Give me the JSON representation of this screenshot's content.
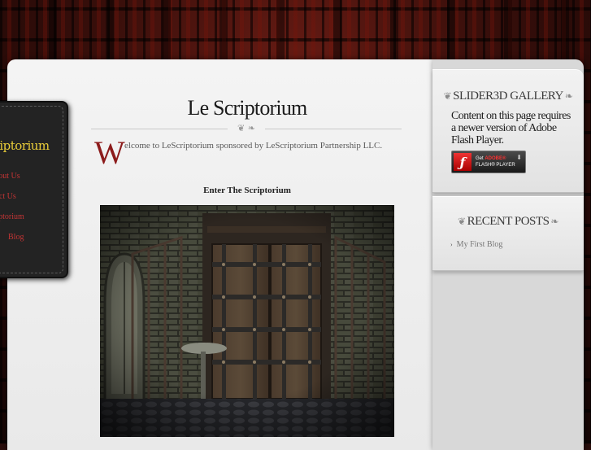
{
  "nav": {
    "title": "Scriptorium",
    "items": [
      "About Us",
      "Contact Us",
      "Scriptorium",
      "Blog"
    ]
  },
  "main": {
    "site_title": "Le Scriptorium",
    "drop_cap": "W",
    "intro": "elcome to LeScriptorium sponsored by LeScriptorium Partnership LLC.",
    "enter_link": "Enter The Scriptorium"
  },
  "sidebar": {
    "gallery_title": "SLIDER3D GALLERY",
    "flash_message": "Content on this page requires a newer version of Adobe Flash Player.",
    "flash_badge": {
      "line1_prefix": "Get",
      "line1_brand": "ADOBE®",
      "line2": "FLASH® PLAYER"
    },
    "recent_title": "RECENT POSTS",
    "recent_posts": [
      "My First Blog"
    ]
  },
  "colors": {
    "accent_red": "#8c1b1b",
    "nav_title_gold": "#e9cc39",
    "nav_link_red": "#c23434"
  }
}
